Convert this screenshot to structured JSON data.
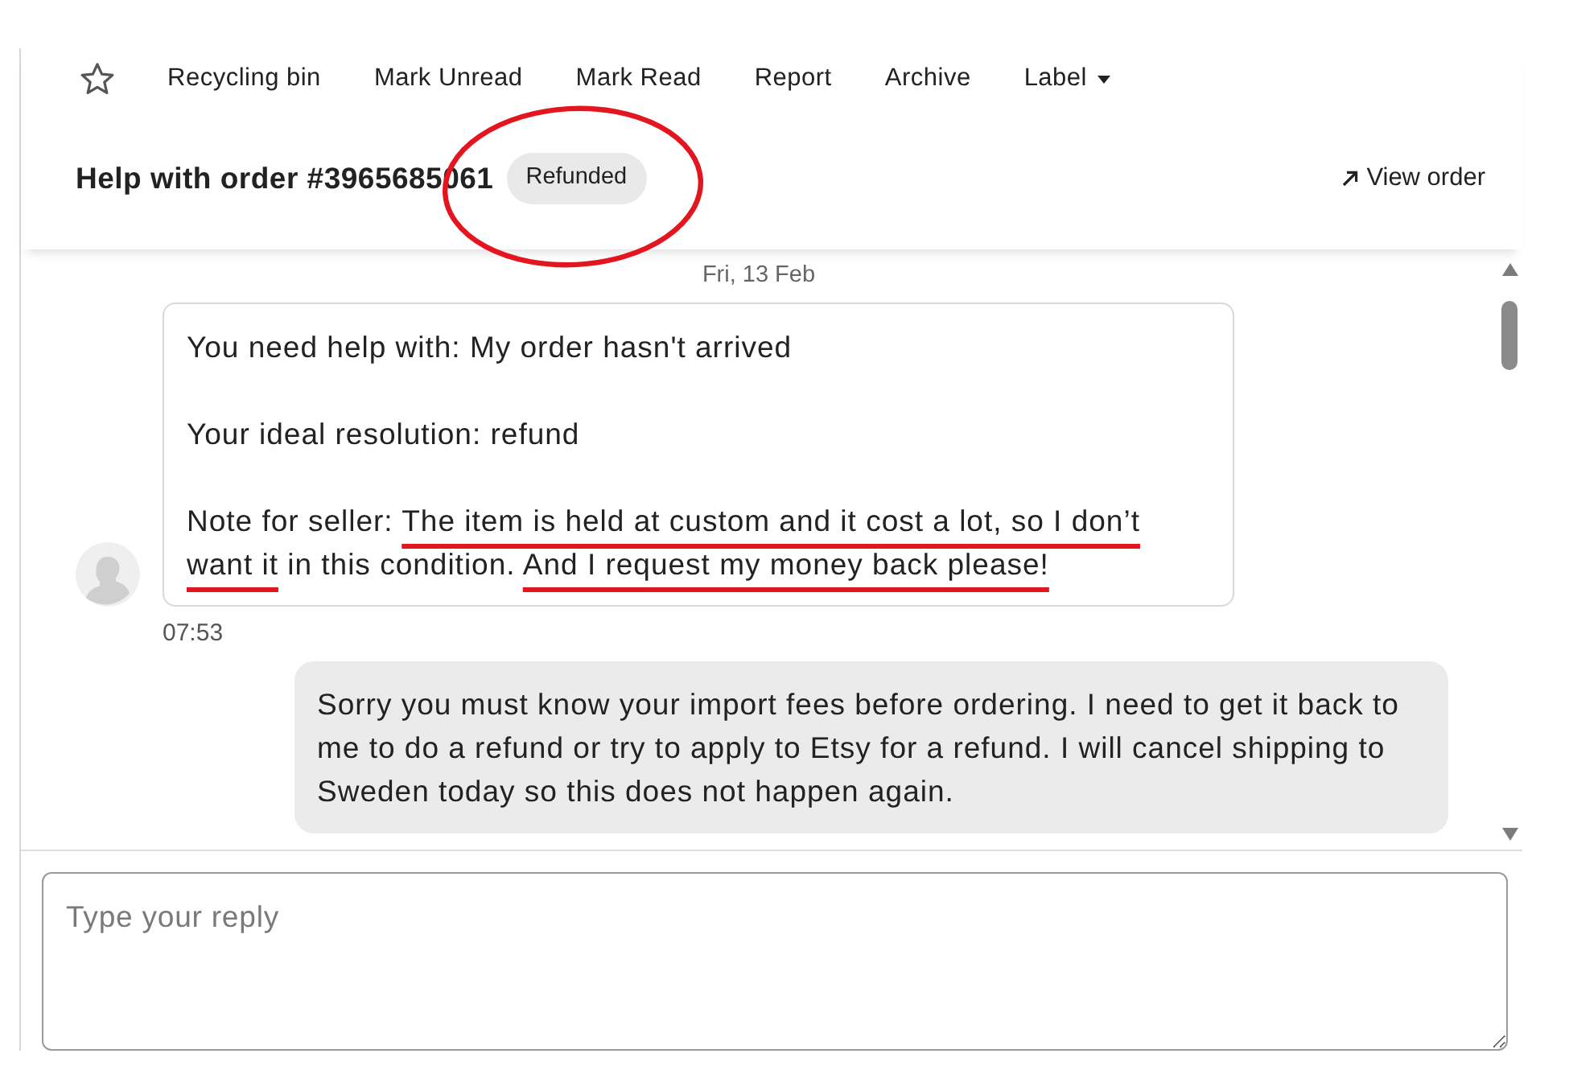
{
  "toolbar": {
    "starred": false,
    "actions": [
      {
        "kind": "button",
        "label": "Recycling bin"
      },
      {
        "kind": "button",
        "label": "Mark Unread"
      },
      {
        "kind": "button",
        "label": "Mark Read"
      },
      {
        "kind": "button",
        "label": "Report"
      },
      {
        "kind": "button",
        "label": "Archive"
      },
      {
        "kind": "dropdown",
        "label": "Label"
      }
    ]
  },
  "header": {
    "title": "Help with order #3965685061",
    "status": {
      "label": "Refunded",
      "circled": true
    },
    "link": "View order"
  },
  "conversation": {
    "date": "Fri, 13 Feb",
    "messages": [
      {
        "kind": "received",
        "paragraphs": [
          {
            "segments": [
              {
                "text": "You need help with: My order hasn't arrived",
                "underlined": false
              }
            ]
          },
          {
            "segments": [
              {
                "text": "Your ideal resolution: refund",
                "underlined": false
              }
            ]
          },
          {
            "segments": [
              {
                "text": "Note for seller: ",
                "underlined": false
              },
              {
                "text": "The item is held at custom and it cost a lot, so I don’t want it",
                "underlined": true
              },
              {
                "text": " in this condition. ",
                "underlined": false
              },
              {
                "text": "And I request my money back please!",
                "underlined": true
              }
            ]
          }
        ],
        "time": "07:53"
      },
      {
        "kind": "sent",
        "text": "Sorry you must know your import fees before ordering. I need to get it back to me to do a refund or try to apply to Etsy for a refund. I will cancel shipping to Sweden today so this does not happen again."
      }
    ]
  },
  "reply": {
    "placeholder": "Type your reply"
  }
}
